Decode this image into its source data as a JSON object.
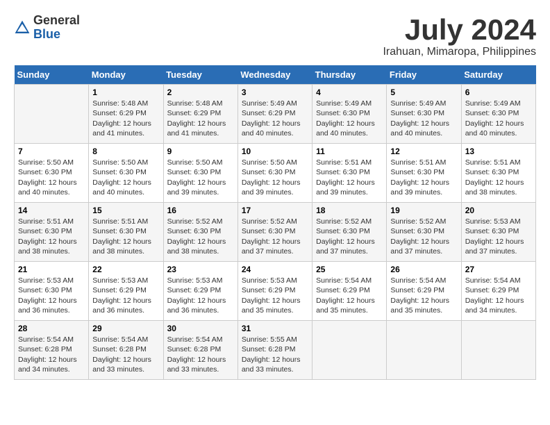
{
  "header": {
    "logo_general": "General",
    "logo_blue": "Blue",
    "month_title": "July 2024",
    "location": "Irahuan, Mimaropa, Philippines"
  },
  "days_of_week": [
    "Sunday",
    "Monday",
    "Tuesday",
    "Wednesday",
    "Thursday",
    "Friday",
    "Saturday"
  ],
  "weeks": [
    [
      {
        "day": "",
        "sunrise": "",
        "sunset": "",
        "daylight": ""
      },
      {
        "day": "1",
        "sunrise": "Sunrise: 5:48 AM",
        "sunset": "Sunset: 6:29 PM",
        "daylight": "Daylight: 12 hours and 41 minutes."
      },
      {
        "day": "2",
        "sunrise": "Sunrise: 5:48 AM",
        "sunset": "Sunset: 6:29 PM",
        "daylight": "Daylight: 12 hours and 41 minutes."
      },
      {
        "day": "3",
        "sunrise": "Sunrise: 5:49 AM",
        "sunset": "Sunset: 6:29 PM",
        "daylight": "Daylight: 12 hours and 40 minutes."
      },
      {
        "day": "4",
        "sunrise": "Sunrise: 5:49 AM",
        "sunset": "Sunset: 6:30 PM",
        "daylight": "Daylight: 12 hours and 40 minutes."
      },
      {
        "day": "5",
        "sunrise": "Sunrise: 5:49 AM",
        "sunset": "Sunset: 6:30 PM",
        "daylight": "Daylight: 12 hours and 40 minutes."
      },
      {
        "day": "6",
        "sunrise": "Sunrise: 5:49 AM",
        "sunset": "Sunset: 6:30 PM",
        "daylight": "Daylight: 12 hours and 40 minutes."
      }
    ],
    [
      {
        "day": "7",
        "sunrise": "Sunrise: 5:50 AM",
        "sunset": "Sunset: 6:30 PM",
        "daylight": "Daylight: 12 hours and 40 minutes."
      },
      {
        "day": "8",
        "sunrise": "Sunrise: 5:50 AM",
        "sunset": "Sunset: 6:30 PM",
        "daylight": "Daylight: 12 hours and 40 minutes."
      },
      {
        "day": "9",
        "sunrise": "Sunrise: 5:50 AM",
        "sunset": "Sunset: 6:30 PM",
        "daylight": "Daylight: 12 hours and 39 minutes."
      },
      {
        "day": "10",
        "sunrise": "Sunrise: 5:50 AM",
        "sunset": "Sunset: 6:30 PM",
        "daylight": "Daylight: 12 hours and 39 minutes."
      },
      {
        "day": "11",
        "sunrise": "Sunrise: 5:51 AM",
        "sunset": "Sunset: 6:30 PM",
        "daylight": "Daylight: 12 hours and 39 minutes."
      },
      {
        "day": "12",
        "sunrise": "Sunrise: 5:51 AM",
        "sunset": "Sunset: 6:30 PM",
        "daylight": "Daylight: 12 hours and 39 minutes."
      },
      {
        "day": "13",
        "sunrise": "Sunrise: 5:51 AM",
        "sunset": "Sunset: 6:30 PM",
        "daylight": "Daylight: 12 hours and 38 minutes."
      }
    ],
    [
      {
        "day": "14",
        "sunrise": "Sunrise: 5:51 AM",
        "sunset": "Sunset: 6:30 PM",
        "daylight": "Daylight: 12 hours and 38 minutes."
      },
      {
        "day": "15",
        "sunrise": "Sunrise: 5:51 AM",
        "sunset": "Sunset: 6:30 PM",
        "daylight": "Daylight: 12 hours and 38 minutes."
      },
      {
        "day": "16",
        "sunrise": "Sunrise: 5:52 AM",
        "sunset": "Sunset: 6:30 PM",
        "daylight": "Daylight: 12 hours and 38 minutes."
      },
      {
        "day": "17",
        "sunrise": "Sunrise: 5:52 AM",
        "sunset": "Sunset: 6:30 PM",
        "daylight": "Daylight: 12 hours and 37 minutes."
      },
      {
        "day": "18",
        "sunrise": "Sunrise: 5:52 AM",
        "sunset": "Sunset: 6:30 PM",
        "daylight": "Daylight: 12 hours and 37 minutes."
      },
      {
        "day": "19",
        "sunrise": "Sunrise: 5:52 AM",
        "sunset": "Sunset: 6:30 PM",
        "daylight": "Daylight: 12 hours and 37 minutes."
      },
      {
        "day": "20",
        "sunrise": "Sunrise: 5:53 AM",
        "sunset": "Sunset: 6:30 PM",
        "daylight": "Daylight: 12 hours and 37 minutes."
      }
    ],
    [
      {
        "day": "21",
        "sunrise": "Sunrise: 5:53 AM",
        "sunset": "Sunset: 6:30 PM",
        "daylight": "Daylight: 12 hours and 36 minutes."
      },
      {
        "day": "22",
        "sunrise": "Sunrise: 5:53 AM",
        "sunset": "Sunset: 6:29 PM",
        "daylight": "Daylight: 12 hours and 36 minutes."
      },
      {
        "day": "23",
        "sunrise": "Sunrise: 5:53 AM",
        "sunset": "Sunset: 6:29 PM",
        "daylight": "Daylight: 12 hours and 36 minutes."
      },
      {
        "day": "24",
        "sunrise": "Sunrise: 5:53 AM",
        "sunset": "Sunset: 6:29 PM",
        "daylight": "Daylight: 12 hours and 35 minutes."
      },
      {
        "day": "25",
        "sunrise": "Sunrise: 5:54 AM",
        "sunset": "Sunset: 6:29 PM",
        "daylight": "Daylight: 12 hours and 35 minutes."
      },
      {
        "day": "26",
        "sunrise": "Sunrise: 5:54 AM",
        "sunset": "Sunset: 6:29 PM",
        "daylight": "Daylight: 12 hours and 35 minutes."
      },
      {
        "day": "27",
        "sunrise": "Sunrise: 5:54 AM",
        "sunset": "Sunset: 6:29 PM",
        "daylight": "Daylight: 12 hours and 34 minutes."
      }
    ],
    [
      {
        "day": "28",
        "sunrise": "Sunrise: 5:54 AM",
        "sunset": "Sunset: 6:28 PM",
        "daylight": "Daylight: 12 hours and 34 minutes."
      },
      {
        "day": "29",
        "sunrise": "Sunrise: 5:54 AM",
        "sunset": "Sunset: 6:28 PM",
        "daylight": "Daylight: 12 hours and 33 minutes."
      },
      {
        "day": "30",
        "sunrise": "Sunrise: 5:54 AM",
        "sunset": "Sunset: 6:28 PM",
        "daylight": "Daylight: 12 hours and 33 minutes."
      },
      {
        "day": "31",
        "sunrise": "Sunrise: 5:55 AM",
        "sunset": "Sunset: 6:28 PM",
        "daylight": "Daylight: 12 hours and 33 minutes."
      },
      {
        "day": "",
        "sunrise": "",
        "sunset": "",
        "daylight": ""
      },
      {
        "day": "",
        "sunrise": "",
        "sunset": "",
        "daylight": ""
      },
      {
        "day": "",
        "sunrise": "",
        "sunset": "",
        "daylight": ""
      }
    ]
  ]
}
